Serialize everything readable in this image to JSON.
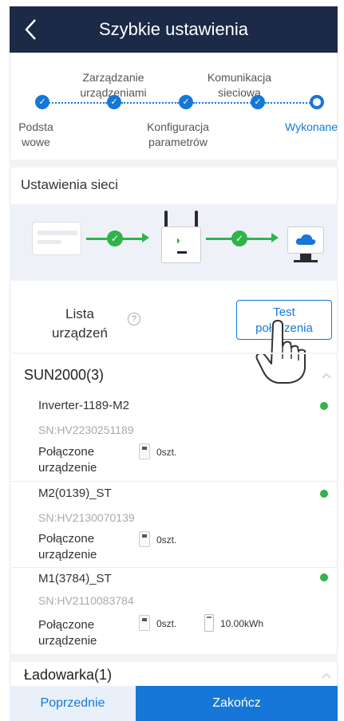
{
  "header": {
    "title": "Szybkie ustawienia"
  },
  "steps": [
    {
      "label": "Podsta\nwowe",
      "state": "done"
    },
    {
      "label": "Zarządzanie\nurządzeniami",
      "state": "done"
    },
    {
      "label": "Konfiguracja\nparametrów",
      "state": "done"
    },
    {
      "label": "Komunikacja\nsieciowa",
      "state": "done"
    },
    {
      "label": "Wykonane",
      "state": "current"
    }
  ],
  "network": {
    "title": "Ustawienia sieci"
  },
  "device_list": {
    "label": "Lista\nurządzeń",
    "help_icon": "help-icon",
    "test_button": "Test\npołączenia"
  },
  "groups": [
    {
      "title": "SUN2000(3)",
      "devices": [
        {
          "name": "Inverter-1189-M2",
          "sn": "SN:HV2230251189",
          "connected_label": "Połączone\nurządzenie",
          "count": "0szt.",
          "status": "online"
        },
        {
          "name": "M2(0139)_ST",
          "sn": "SN:HV2130070139",
          "connected_label": "Połączone\nurządzenie",
          "count": "0szt.",
          "status": "online"
        },
        {
          "name": "M1(3784)_ST",
          "sn": "SN:HV2110083784",
          "connected_label": "Połączone\nurządzenie",
          "count": "0szt.",
          "battery": "10.00kWh",
          "status": "online"
        }
      ]
    },
    {
      "title": "Ładowarka(1)",
      "devices": []
    }
  ],
  "footer": {
    "prev": "Poprzednie",
    "finish": "Zakończ"
  },
  "colors": {
    "header": "#1b2a47",
    "accent": "#1677d8",
    "ok": "#2fb34a"
  }
}
